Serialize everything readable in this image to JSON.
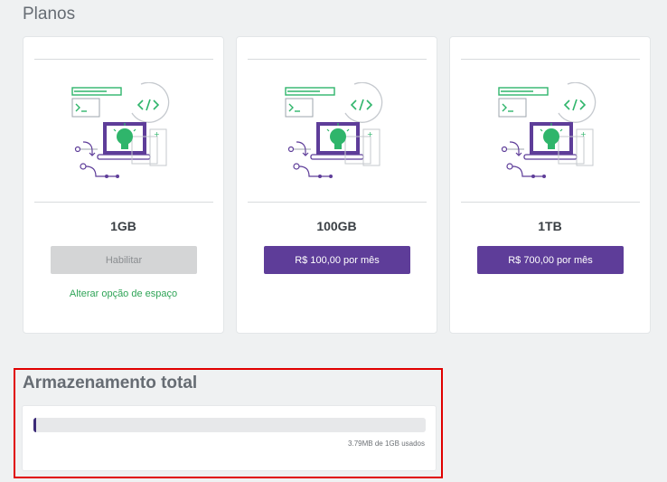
{
  "plans": {
    "title": "Planos",
    "items": [
      {
        "size": "1GB",
        "button_label": "Habilitar",
        "button_state": "disabled",
        "link": "Alterar opção de espaço"
      },
      {
        "size": "100GB",
        "button_label": "R$ 100,00 por mês",
        "button_state": "primary"
      },
      {
        "size": "1TB",
        "button_label": "R$ 700,00 por mês",
        "button_state": "primary"
      }
    ]
  },
  "storage": {
    "title": "Armazenamento total",
    "used_fraction": 0.0037,
    "usage_text": "3.79MB de 1GB usados"
  },
  "colors": {
    "accent": "#5e3d99",
    "link": "#2fa457",
    "highlight": "#e00000",
    "illustration_green": "#2fb56b",
    "illustration_purple": "#5e3d99"
  },
  "icons": [
    "terminal-icon",
    "code-icon",
    "lightbulb-icon",
    "laptop-icon"
  ]
}
